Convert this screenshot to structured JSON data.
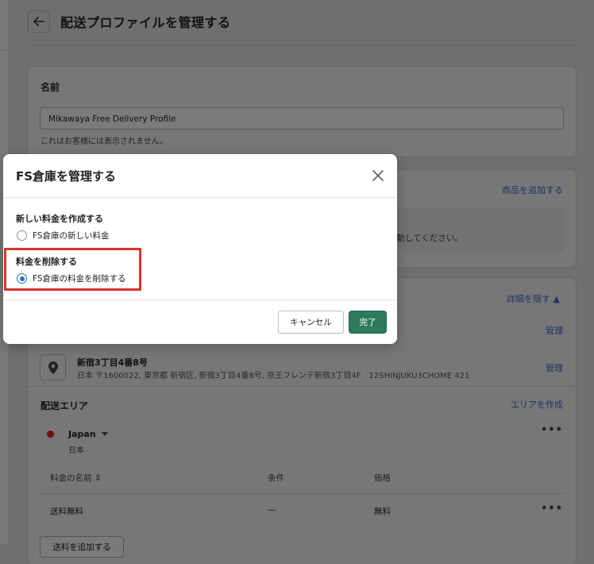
{
  "page": {
    "title": "配送プロファイルを管理する",
    "name_section": {
      "label": "名前",
      "input_value": "Mikawaya Free Delivery Profile",
      "help_text": "これはお客様には表示されません。"
    },
    "products_section": {
      "add_product_link": "商品を追加する",
      "partial_text": "移動してください。"
    },
    "locations_section": {
      "hide_details_link": "詳細を隠す ▲",
      "manage_link_1": "管理",
      "manage_link_2": "管理",
      "location_name": "新宿3丁目4番8号",
      "location_address": "日本 〒1600022, 東京都 新宿区, 新宿3丁目4番8号, 京王フレンテ新宿3丁目4F　12SHINJUKU3CHOME 421"
    },
    "zones_section": {
      "title": "配送エリア",
      "create_zone_link": "エリアを作成",
      "zone_country": "Japan",
      "zone_sub": "日本",
      "more_actions": "•••",
      "table": {
        "headers": [
          "料金の名前 ⇕",
          "条件",
          "価格"
        ],
        "rows": [
          {
            "name": "送料無料",
            "condition": "—",
            "price": "無料"
          }
        ]
      },
      "add_rate_button": "送料を追加する"
    }
  },
  "modal": {
    "title": "FS倉庫を管理する",
    "section1_label": "新しい料金を作成する",
    "option1": "FS倉庫の新しい料金",
    "section2_label": "料金を削除する",
    "option2": "FS倉庫の料金を削除する",
    "selected_option": "option2",
    "cancel_button": "キャンセル",
    "done_button": "完了"
  },
  "colors": {
    "primary_button": "#2e7a5c",
    "radio_selected": "#2c6ecb",
    "highlight_border": "#d9342b",
    "zone_dot": "#6e1010"
  }
}
